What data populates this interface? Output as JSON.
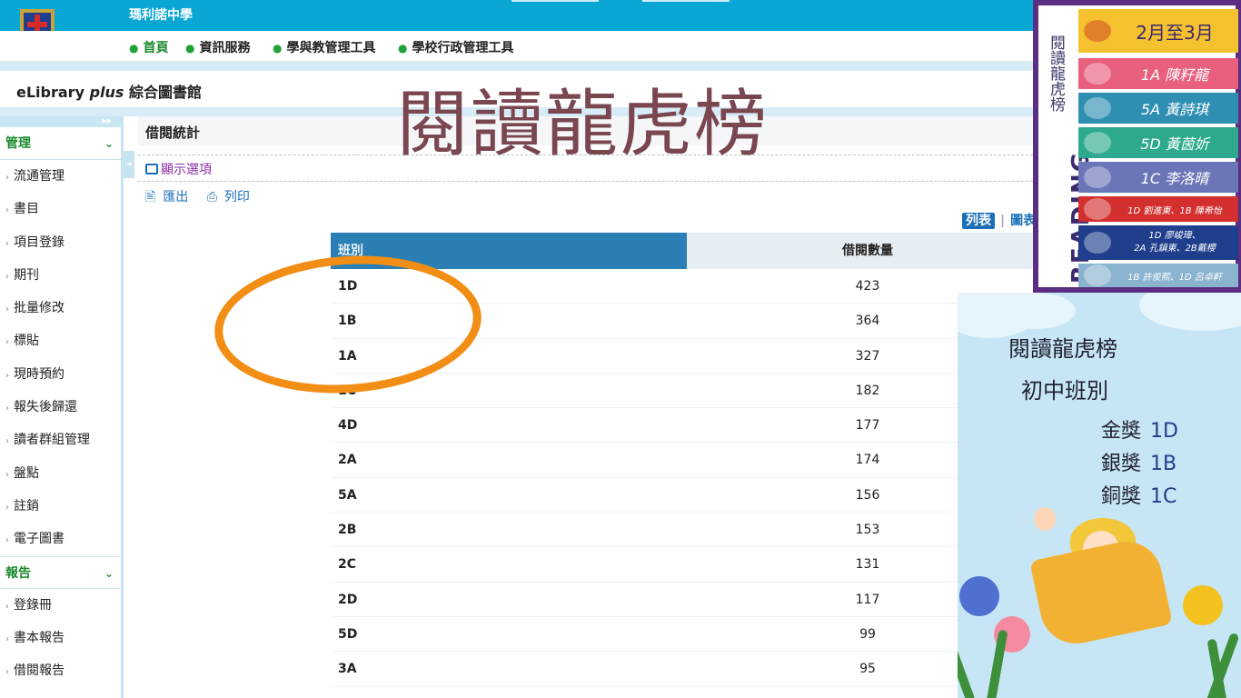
{
  "header": {
    "school_name": "瑪利諾中學",
    "nav": [
      "首頁",
      "資訊服務",
      "學與教管理工具",
      "學校行政管理工具"
    ]
  },
  "app_title_prefix": "eLibrary ",
  "app_title_italic": "plus",
  "app_title_suffix": " 綜合圖書館",
  "sidebar": {
    "group1": "管理",
    "items1": [
      "流通管理",
      "書目",
      "項目登錄",
      "期刊",
      "批量修改",
      "標貼",
      "現時預約",
      "報失後歸還",
      "讀者群組管理",
      "盤點",
      "註銷",
      "電子圖書"
    ],
    "group2": "報告",
    "items2": [
      "登錄冊",
      "書本報告",
      "借閱報告"
    ]
  },
  "section_title": "借閱統計",
  "options_link": "顯示選項",
  "export_label": "匯出",
  "print_label": "列印",
  "view_list": "列表",
  "view_chart": "圖表",
  "overlay_title": "閱讀龍虎榜",
  "table": {
    "headers": [
      "班別",
      "借閱數量"
    ],
    "rows": [
      [
        "1D",
        "423"
      ],
      [
        "1B",
        "364"
      ],
      [
        "1A",
        "327"
      ],
      [
        "1C",
        "182"
      ],
      [
        "4D",
        "177"
      ],
      [
        "2A",
        "174"
      ],
      [
        "5A",
        "156"
      ],
      [
        "2B",
        "153"
      ],
      [
        "2C",
        "131"
      ],
      [
        "2D",
        "117"
      ],
      [
        "5D",
        "99"
      ],
      [
        "3A",
        "95"
      ]
    ]
  },
  "poster": {
    "side_title": "閱讀龍虎榜",
    "brand": "READING",
    "period": "2月至3月",
    "entries": [
      "1A 陳籽龍",
      "5A 黃詩琪",
      "5D 黃茵妡",
      "1C 李洛晴",
      "1D 劉進東、1B 陳希怡",
      "1D 廖峻瑋、",
      "2A 孔鎮東、2B戴櫻",
      "1B 許俊熙、1D 呂卓軒"
    ]
  },
  "promo": {
    "title": "閱讀龍虎榜",
    "subtitle": "初中班別",
    "awards": [
      {
        "label": "金獎",
        "value": "1D"
      },
      {
        "label": "銀獎",
        "value": "1B"
      },
      {
        "label": "銅獎",
        "value": "1C"
      }
    ]
  },
  "colors": {
    "topbar": "#0aa6d4",
    "sidebar_accent": "#1b8a2d",
    "table_header": "#2b7fb4",
    "highlight_circle": "#f28e16",
    "poster_border": "#5b2e83"
  }
}
